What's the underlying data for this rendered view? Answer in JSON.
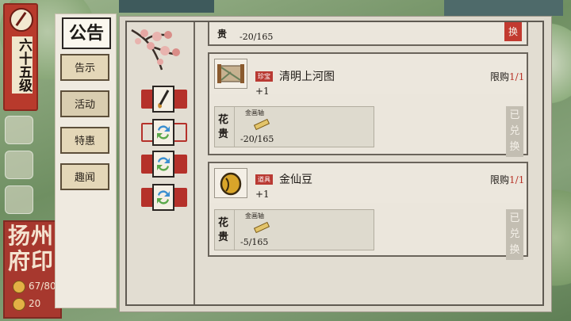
{
  "player": {
    "level_label": "六十五级"
  },
  "city_banner": {
    "name": "扬州府印",
    "stat1": "67/80",
    "stat2": "20"
  },
  "notice_panel": {
    "title": "公告",
    "tabs": [
      {
        "label": "告示",
        "active": false
      },
      {
        "label": "活动",
        "active": true
      },
      {
        "label": "特惠",
        "active": false
      },
      {
        "label": "趣闻",
        "active": false
      }
    ]
  },
  "partial_item": {
    "cost_label": "贵",
    "cost_value": "-20/165",
    "redeem_fragment": "换"
  },
  "items": [
    {
      "badge": "珍宝",
      "name": "清明上河图",
      "quantity": "+1",
      "limit_label": "限购",
      "limit_value": "1/1",
      "cost_label": "花贵",
      "resource_name": "金画轴",
      "cost_value": "-20/165",
      "status": "已兑换",
      "icon": "scroll-painting-icon"
    },
    {
      "badge": "道具",
      "name": "金仙豆",
      "quantity": "+1",
      "limit_label": "限购",
      "limit_value": "1/1",
      "cost_label": "花贵",
      "resource_name": "金画轴",
      "cost_value": "-5/165",
      "status": "已兑换",
      "icon": "golden-bean-icon"
    }
  ],
  "colors": {
    "accent_red": "#b5312a",
    "paper": "#ebe6dc",
    "ink": "#1e1a16"
  }
}
